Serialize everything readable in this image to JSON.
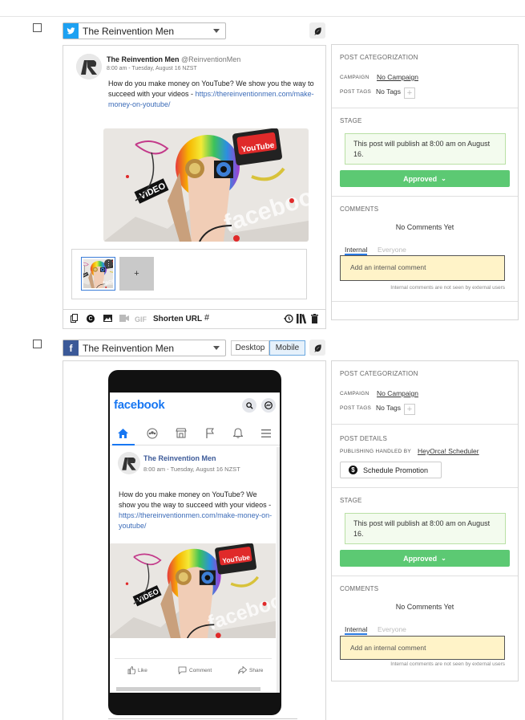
{
  "post1": {
    "account_name": "The Reinvention Men",
    "network": "twitter",
    "preview": {
      "display_name": "The Reinvention Men",
      "handle": "@ReinventionMen",
      "timestamp": "8:00 am - Tuesday, August 16 NZST",
      "text": "How do you make money on YouTube? We show you the way to succeed with your videos - ",
      "link": "https://thereinventionmen.com/make-money-on-youtube/",
      "add_media_label": "+"
    },
    "toolbar": {
      "gif_label": "GIF",
      "shorten_url_label": "Shorten URL",
      "hashtag_label": "#"
    },
    "categorization": {
      "title": "POST CATEGORIZATION",
      "campaign_label": "CAMPAIGN",
      "campaign_value": "No Campaign",
      "tags_label": "POST TAGS",
      "tags_value": "No Tags",
      "add_tag": "+"
    },
    "stage": {
      "title": "STAGE",
      "note": "This post will publish at 8:00 am on August 16.",
      "status": "Approved",
      "status_caret": "⌄"
    },
    "comments": {
      "title": "COMMENTS",
      "empty": "No Comments Yet",
      "tab_internal": "Internal",
      "tab_everyone": "Everyone",
      "placeholder": "Add an internal comment",
      "note": "Internal comments are not seen by external users"
    }
  },
  "post2": {
    "account_name": "The Reinvention Men",
    "network": "facebook",
    "view_desktop": "Desktop",
    "view_mobile": "Mobile",
    "preview": {
      "fb_logo": "facebook",
      "display_name": "The Reinvention Men",
      "timestamp": "8:00 am - Tuesday, August 16 NZST",
      "text": "How do you make money on YouTube? We show you the way to succeed with your videos - ",
      "link": "https://thereinventionmen.com/make-money-on-youtube/",
      "like_label": "Like",
      "comment_label": "Comment",
      "share_label": "Share"
    },
    "categorization": {
      "title": "POST CATEGORIZATION",
      "campaign_label": "CAMPAIGN",
      "campaign_value": "No Campaign",
      "tags_label": "POST TAGS",
      "tags_value": "No Tags",
      "add_tag": "+"
    },
    "details": {
      "title": "POST DETAILS",
      "handled_label": "PUBLISHING HANDLED BY",
      "handled_value": "HeyOrca! Scheduler",
      "promo_button": "Schedule Promotion"
    },
    "stage": {
      "title": "STAGE",
      "note": "This post will publish at 8:00 am on August 16.",
      "status": "Approved",
      "status_caret": "⌄"
    },
    "comments": {
      "title": "COMMENTS",
      "empty": "No Comments Yet",
      "tab_internal": "Internal",
      "tab_everyone": "Everyone",
      "placeholder": "Add an internal comment",
      "note": "Internal comments are not seen by external users"
    }
  },
  "colors": {
    "twitter": "#1da1f2",
    "facebook": "#3b5998",
    "approved": "#5cc973",
    "comment_bg": "#fff3c8"
  },
  "icons": [
    "checkbox",
    "twitter-icon",
    "facebook-icon",
    "leaf-icon",
    "copy-icon",
    "copyright-icon",
    "image-icon",
    "video-icon",
    "history-icon",
    "library-icon",
    "trash-icon",
    "search-icon",
    "messenger-icon",
    "home-icon",
    "groups-icon",
    "marketplace-icon",
    "flag-icon",
    "bell-icon",
    "menu-icon",
    "like-icon",
    "comment-icon",
    "share-icon",
    "dollar-icon"
  ]
}
